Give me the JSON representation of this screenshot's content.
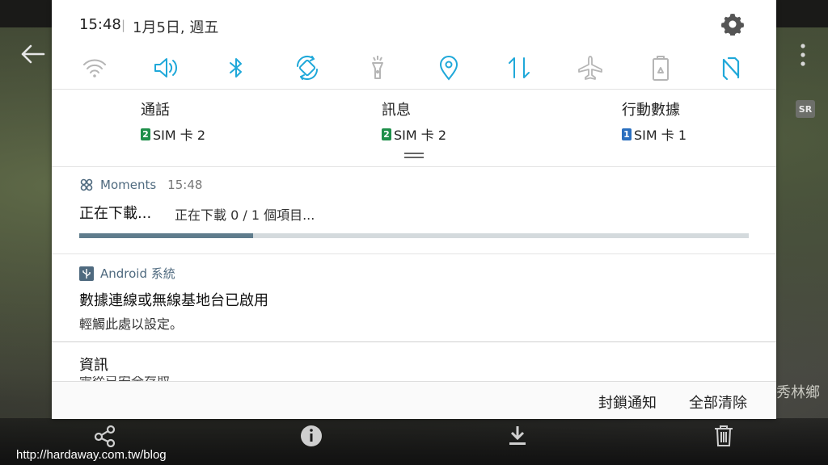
{
  "status": {
    "time": "15:48",
    "separator": "|",
    "date": "1月5日, 週五"
  },
  "quick_settings": [
    {
      "icon": "wifi-icon",
      "active": false
    },
    {
      "icon": "sound-icon",
      "active": true
    },
    {
      "icon": "bluetooth-icon",
      "active": true
    },
    {
      "icon": "auto-rotate-icon",
      "active": true
    },
    {
      "icon": "flashlight-icon",
      "active": false
    },
    {
      "icon": "location-icon",
      "active": true
    },
    {
      "icon": "mobile-data-icon",
      "active": true
    },
    {
      "icon": "airplane-mode-icon",
      "active": false
    },
    {
      "icon": "power-saving-icon",
      "active": false
    },
    {
      "icon": "nfc-icon",
      "active": true
    }
  ],
  "sim_settings": [
    {
      "title": "通話",
      "badge": "2",
      "sim_label": "SIM 卡 2",
      "badge_color": "#1e8f4a"
    },
    {
      "title": "訊息",
      "badge": "2",
      "sim_label": "SIM 卡 2",
      "badge_color": "#1e8f4a"
    },
    {
      "title": "行動數據",
      "badge": "1",
      "sim_label": "SIM 卡 1",
      "badge_color": "#2a6fbf"
    }
  ],
  "notifications": {
    "moments": {
      "app": "Moments",
      "time": "15:48",
      "title": "正在下載...",
      "text": "正在下載 0 / 1 個項目...",
      "progress": 0.26
    },
    "android": {
      "app": "Android 系統",
      "title": "數據連線或無線基地台已啟用",
      "text": "輕觸此處以設定。"
    },
    "peek": {
      "title": "資訊",
      "text": "需從已安全存取"
    }
  },
  "footer": {
    "block": "封鎖通知",
    "clear": "全部清除"
  },
  "background": {
    "place": "秀林鄉",
    "sr_badge": "SR"
  },
  "watermark": "http://hardaway.com.tw/blog",
  "colors": {
    "accent": "#1fa8d9",
    "inactive": "#9a9a9a"
  }
}
